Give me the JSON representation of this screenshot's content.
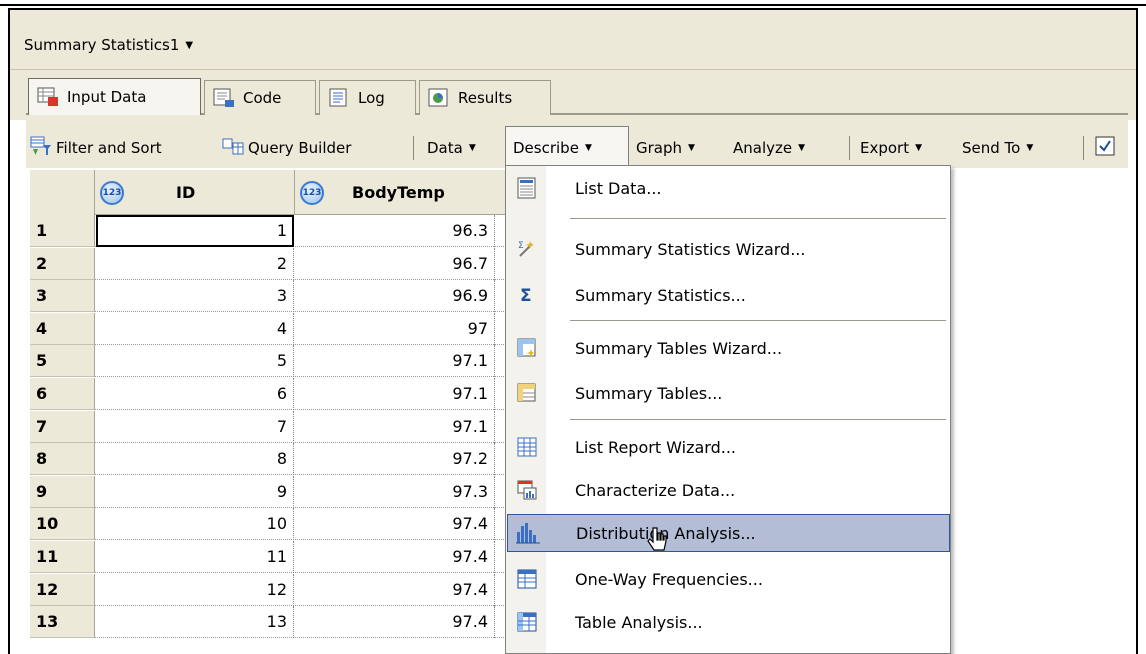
{
  "project": {
    "title": "Summary Statistics1",
    "dropdown_icon": "caret-down-icon"
  },
  "tabs": [
    {
      "label": "Input Data",
      "icon": "input-data-icon",
      "active": true
    },
    {
      "label": "Code",
      "icon": "code-icon",
      "active": false
    },
    {
      "label": "Log",
      "icon": "log-icon",
      "active": false
    },
    {
      "label": "Results",
      "icon": "results-icon",
      "active": false
    }
  ],
  "toolbar": {
    "filter_sort": "Filter and Sort",
    "query_builder": "Query Builder",
    "data": "Data",
    "describe": "Describe",
    "graph": "Graph",
    "analyze": "Analyze",
    "export": "Export",
    "send_to": "Send To"
  },
  "grid": {
    "columns": [
      {
        "name": "ID",
        "type_icon": "numeric-icon",
        "type_text": "123"
      },
      {
        "name": "BodyTemp",
        "type_icon": "numeric-icon",
        "type_text": "123"
      }
    ],
    "rows": [
      {
        "n": "1",
        "id": "1",
        "bodytemp": "96.3"
      },
      {
        "n": "2",
        "id": "2",
        "bodytemp": "96.7"
      },
      {
        "n": "3",
        "id": "3",
        "bodytemp": "96.9"
      },
      {
        "n": "4",
        "id": "4",
        "bodytemp": "97"
      },
      {
        "n": "5",
        "id": "5",
        "bodytemp": "97.1"
      },
      {
        "n": "6",
        "id": "6",
        "bodytemp": "97.1"
      },
      {
        "n": "7",
        "id": "7",
        "bodytemp": "97.1"
      },
      {
        "n": "8",
        "id": "8",
        "bodytemp": "97.2"
      },
      {
        "n": "9",
        "id": "9",
        "bodytemp": "97.3"
      },
      {
        "n": "10",
        "id": "10",
        "bodytemp": "97.4"
      },
      {
        "n": "11",
        "id": "11",
        "bodytemp": "97.4"
      },
      {
        "n": "12",
        "id": "12",
        "bodytemp": "97.4"
      },
      {
        "n": "13",
        "id": "13",
        "bodytemp": "97.4"
      }
    ]
  },
  "describe_menu": {
    "items": [
      {
        "label": "List Data...",
        "icon": "list-data-icon"
      },
      {
        "label": "Summary Statistics Wizard...",
        "icon": "wizard-icon"
      },
      {
        "label": "Summary Statistics...",
        "icon": "sigma-icon"
      },
      {
        "label": "Summary Tables Wizard...",
        "icon": "table-wizard-icon"
      },
      {
        "label": "Summary Tables...",
        "icon": "summary-tables-icon"
      },
      {
        "label": "List Report Wizard...",
        "icon": "list-report-icon"
      },
      {
        "label": "Characterize Data...",
        "icon": "characterize-icon"
      },
      {
        "label": "Distribution Analysis...",
        "icon": "histogram-icon",
        "highlighted": true
      },
      {
        "label": "One-Way Frequencies...",
        "icon": "frequencies-icon"
      },
      {
        "label": "Table Analysis...",
        "icon": "table-analysis-icon"
      }
    ]
  },
  "colors": {
    "chrome": "#ece9d8",
    "menu_highlight": "#b3bdd6",
    "menu_highlight_border": "#31569a"
  }
}
